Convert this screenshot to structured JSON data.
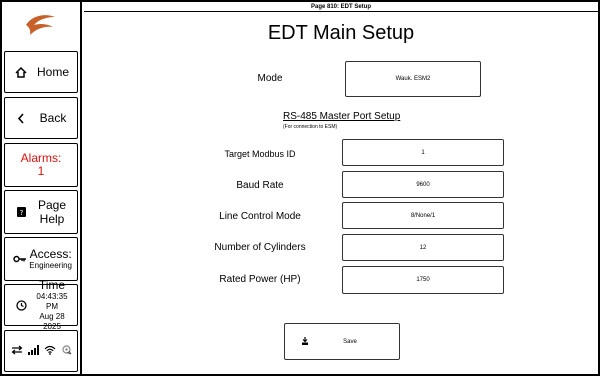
{
  "topbar": {
    "page_title": "Page 810: EDT Setup"
  },
  "main": {
    "title": "EDT Main Setup"
  },
  "sidebar": {
    "home": "Home",
    "back": "Back",
    "alarms_label": "Alarms:",
    "alarms_count": "1",
    "help_line1": "Page",
    "help_line2": "Help",
    "access_label": "Access:",
    "access_level": "Engineering",
    "time_label": "Time",
    "time_value": "04:43:35 PM",
    "date_value": "Aug 28 2025"
  },
  "mode": {
    "label": "Mode",
    "value": "Wauk. ESM2"
  },
  "rs485": {
    "title": "RS-485 Master Port Setup",
    "note": "(For connection to ESM)"
  },
  "fields": {
    "target_modbus_id": {
      "label": "Target Modbus ID",
      "value": "1"
    },
    "baud_rate": {
      "label": "Baud Rate",
      "value": "9600"
    },
    "line_control": {
      "label": "Line Control Mode",
      "value": "8/None/1"
    },
    "cylinders": {
      "label": "Number of Cylinders",
      "value": "12"
    },
    "rated_power": {
      "label": "Rated Power (HP)",
      "value": "1750"
    }
  },
  "save": {
    "label": "Save"
  },
  "colors": {
    "alarm": "#e01010",
    "logo": "#c8602a"
  },
  "icons": [
    "home-icon",
    "back-chevron-icon",
    "help-book-icon",
    "key-icon",
    "clock-icon",
    "transfer-arrows-icon",
    "signal-bars-icon",
    "wifi-icon",
    "gps-off-icon",
    "save-icon"
  ]
}
